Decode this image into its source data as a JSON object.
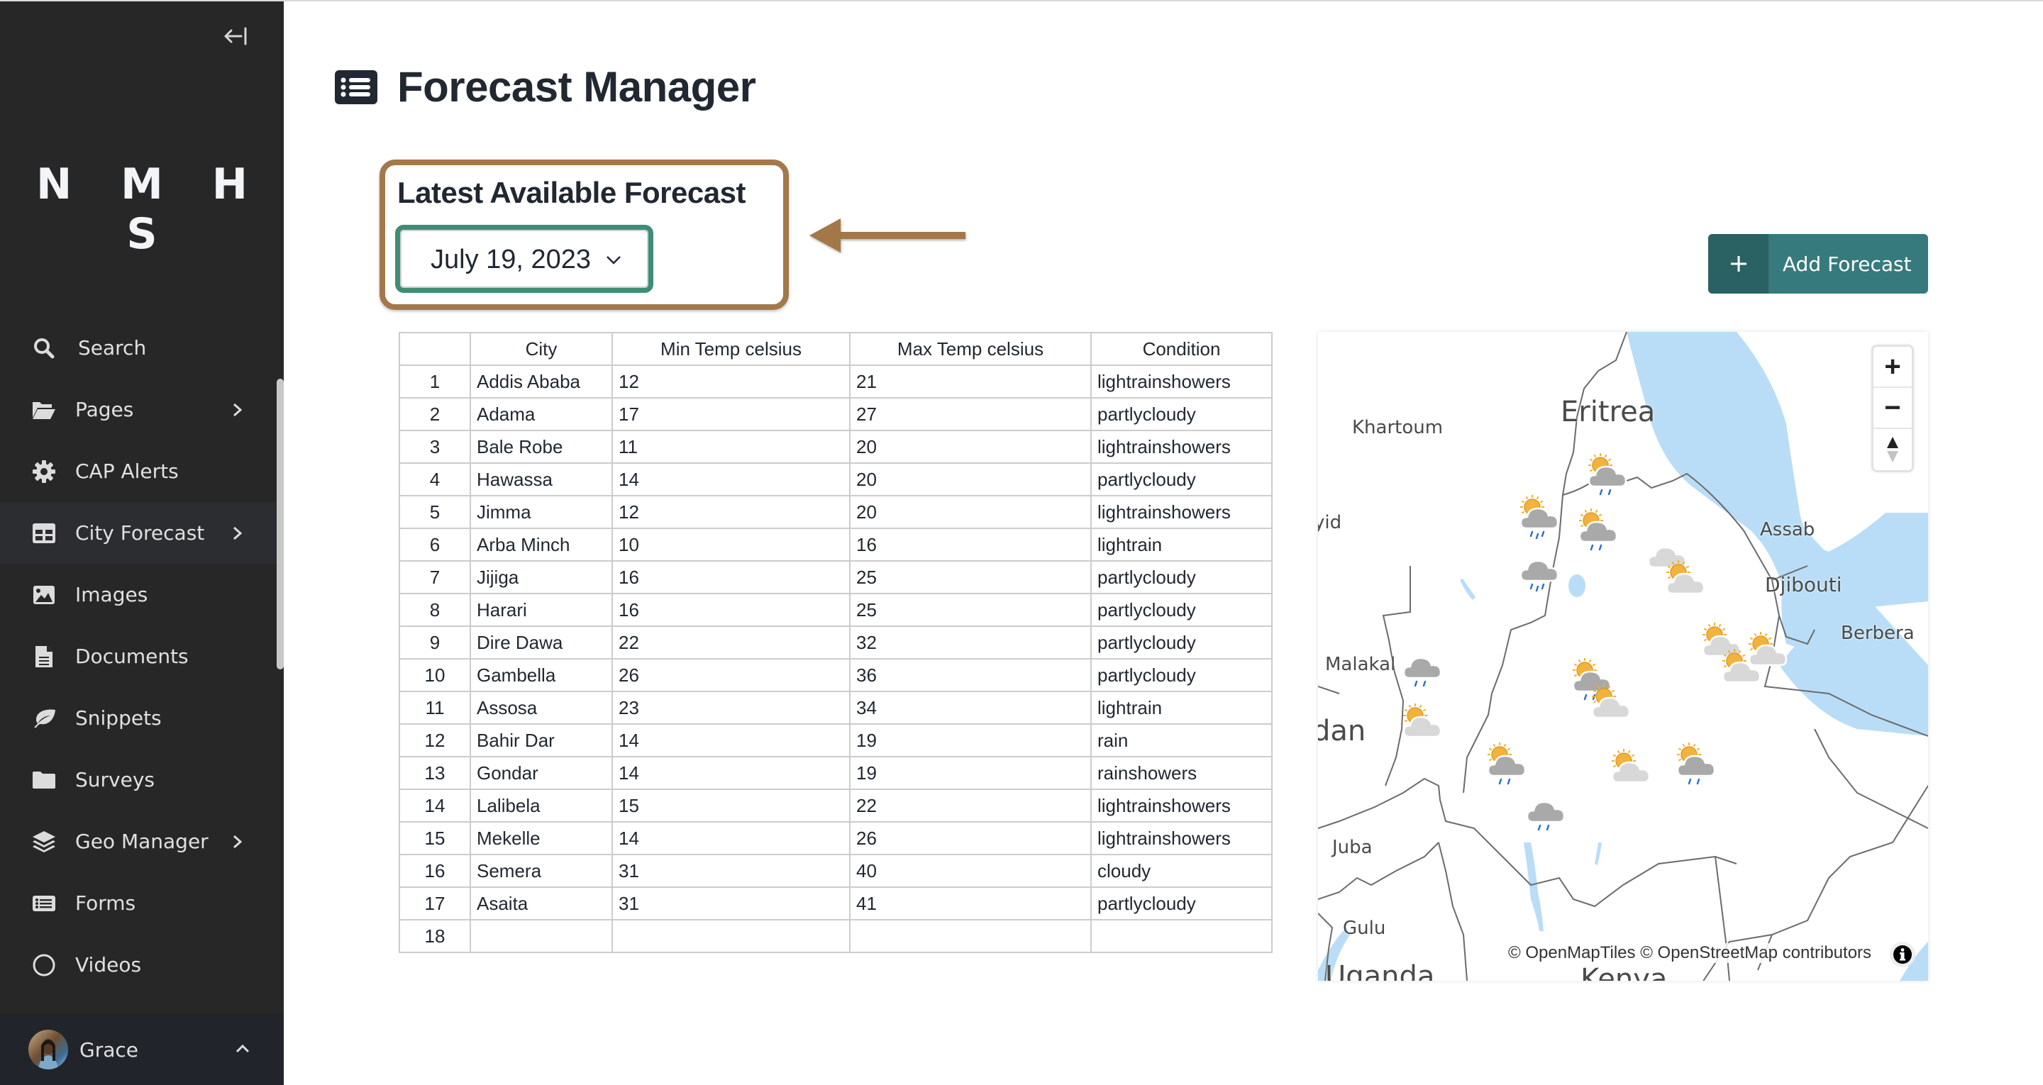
{
  "sidebar": {
    "brand": "N M H S",
    "collapse_icon": "collapse-left-icon",
    "items": [
      {
        "label": "Search",
        "icon": "search-icon",
        "has_submenu": false,
        "active": false
      },
      {
        "label": "Pages",
        "icon": "folder-open-icon",
        "has_submenu": true,
        "active": false
      },
      {
        "label": "CAP Alerts",
        "icon": "gear-icon",
        "has_submenu": false,
        "active": false
      },
      {
        "label": "City Forecast",
        "icon": "table-icon",
        "has_submenu": true,
        "active": true
      },
      {
        "label": "Images",
        "icon": "image-icon",
        "has_submenu": false,
        "active": false
      },
      {
        "label": "Documents",
        "icon": "document-icon",
        "has_submenu": false,
        "active": false
      },
      {
        "label": "Snippets",
        "icon": "leaf-icon",
        "has_submenu": false,
        "active": false
      },
      {
        "label": "Surveys",
        "icon": "folder-icon",
        "has_submenu": false,
        "active": false
      },
      {
        "label": "Geo Manager",
        "icon": "layers-icon",
        "has_submenu": true,
        "active": false
      },
      {
        "label": "Forms",
        "icon": "list-icon",
        "has_submenu": false,
        "active": false
      },
      {
        "label": "Videos",
        "icon": "circle-icon",
        "has_submenu": false,
        "active": false
      }
    ],
    "user": {
      "name": "Grace",
      "caret_icon": "chevron-up-icon"
    }
  },
  "header": {
    "title": "Forecast Manager",
    "title_icon": "list-alt-icon"
  },
  "latest": {
    "title": "Latest Available Forecast",
    "selected_date": "July 19, 2023"
  },
  "annotation": {
    "highlight_color": "#a3784a",
    "arrow_direction": "left"
  },
  "add_button": {
    "label": "Add Forecast",
    "icon": "plus-icon",
    "color": "#377a7d"
  },
  "table": {
    "columns": [
      "",
      "City",
      "Min Temp celsius",
      "Max Temp celsius",
      "Condition"
    ],
    "rows": [
      {
        "idx": "1",
        "city": "Addis Ababa",
        "min": "12",
        "max": "21",
        "condition": "lightrainshowers"
      },
      {
        "idx": "2",
        "city": "Adama",
        "min": "17",
        "max": "27",
        "condition": "partlycloudy"
      },
      {
        "idx": "3",
        "city": "Bale Robe",
        "min": "11",
        "max": "20",
        "condition": "lightrainshowers"
      },
      {
        "idx": "4",
        "city": "Hawassa",
        "min": "14",
        "max": "20",
        "condition": "partlycloudy"
      },
      {
        "idx": "5",
        "city": "Jimma",
        "min": "12",
        "max": "20",
        "condition": "lightrainshowers"
      },
      {
        "idx": "6",
        "city": "Arba Minch",
        "min": "10",
        "max": "16",
        "condition": "lightrain"
      },
      {
        "idx": "7",
        "city": "Jijiga",
        "min": "16",
        "max": "25",
        "condition": "partlycloudy"
      },
      {
        "idx": "8",
        "city": "Harari",
        "min": "16",
        "max": "25",
        "condition": "partlycloudy"
      },
      {
        "idx": "9",
        "city": "Dire Dawa",
        "min": "22",
        "max": "32",
        "condition": "partlycloudy"
      },
      {
        "idx": "10",
        "city": "Gambella",
        "min": "26",
        "max": "36",
        "condition": "partlycloudy"
      },
      {
        "idx": "11",
        "city": "Assosa",
        "min": "23",
        "max": "34",
        "condition": "lightrain"
      },
      {
        "idx": "12",
        "city": "Bahir Dar",
        "min": "14",
        "max": "19",
        "condition": "rain"
      },
      {
        "idx": "13",
        "city": "Gondar",
        "min": "14",
        "max": "19",
        "condition": "rainshowers"
      },
      {
        "idx": "14",
        "city": "Lalibela",
        "min": "15",
        "max": "22",
        "condition": "lightrainshowers"
      },
      {
        "idx": "15",
        "city": "Mekelle",
        "min": "14",
        "max": "26",
        "condition": "lightrainshowers"
      },
      {
        "idx": "16",
        "city": "Semera",
        "min": "31",
        "max": "40",
        "condition": "cloudy"
      },
      {
        "idx": "17",
        "city": "Asaita",
        "min": "31",
        "max": "41",
        "condition": "partlycloudy"
      },
      {
        "idx": "18",
        "city": "",
        "min": "",
        "max": "",
        "condition": ""
      }
    ]
  },
  "map": {
    "labels": [
      "Eritrea",
      "Khartoum",
      "yid",
      "Assab",
      "Djibouti",
      "Berbera",
      "Malakal",
      "dan",
      "Juba",
      "Gulu",
      "Uganda",
      "Kenya"
    ],
    "zoom_in": "+",
    "zoom_out": "−",
    "compass_icon": "compass-icon",
    "attribution": "© OpenMapTiles © OpenStreetMap contributors",
    "info_icon": "info-icon",
    "water_color": "#b9ddf6",
    "markers": [
      {
        "city": "Mekelle",
        "icon": "lightrainshowers"
      },
      {
        "city": "Gondar",
        "icon": "rainshowers"
      },
      {
        "city": "Bahir Dar",
        "icon": "rain"
      },
      {
        "city": "Lalibela",
        "icon": "lightrainshowers"
      },
      {
        "city": "Semera",
        "icon": "cloudy"
      },
      {
        "city": "Asaita",
        "icon": "partlycloudy"
      },
      {
        "city": "Assosa",
        "icon": "lightrain"
      },
      {
        "city": "Gambella",
        "icon": "partlycloudy"
      },
      {
        "city": "Addis Ababa",
        "icon": "lightrainshowers"
      },
      {
        "city": "Adama",
        "icon": "partlycloudy"
      },
      {
        "city": "Dire Dawa",
        "icon": "partlycloudy"
      },
      {
        "city": "Harari",
        "icon": "partlycloudy"
      },
      {
        "city": "Jijiga",
        "icon": "partlycloudy"
      },
      {
        "city": "Jimma",
        "icon": "lightrainshowers"
      },
      {
        "city": "Hawassa",
        "icon": "partlycloudy"
      },
      {
        "city": "Bale Robe",
        "icon": "lightrainshowers"
      },
      {
        "city": "Arba Minch",
        "icon": "lightrain"
      }
    ]
  }
}
